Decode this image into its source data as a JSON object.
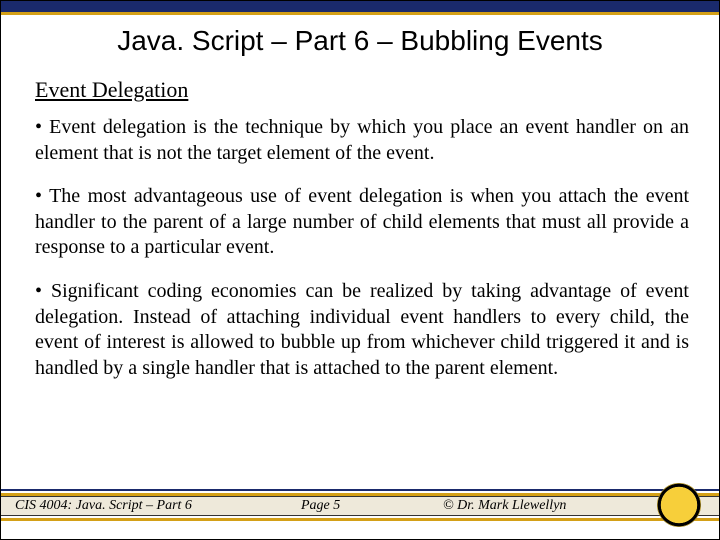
{
  "title": "Java. Script – Part 6 – Bubbling Events",
  "subheading": "Event Delegation",
  "bullets": [
    "Event delegation is the technique by which you place an event handler on an element that is not the target element of the event.",
    "The most advantageous use of event delegation is when you attach the event handler to the parent of a large number of child elements that must all provide a response to a particular event.",
    "Significant coding economies can be realized by taking advantage of event delegation.  Instead of attaching individual event handlers to every child, the event of interest is allowed to bubble up from whichever child triggered it and is handled by a single handler that is attached to the parent element."
  ],
  "footer": {
    "course": "CIS 4004: Java. Script – Part 6",
    "page": "Page 5",
    "author": "© Dr. Mark Llewellyn"
  }
}
